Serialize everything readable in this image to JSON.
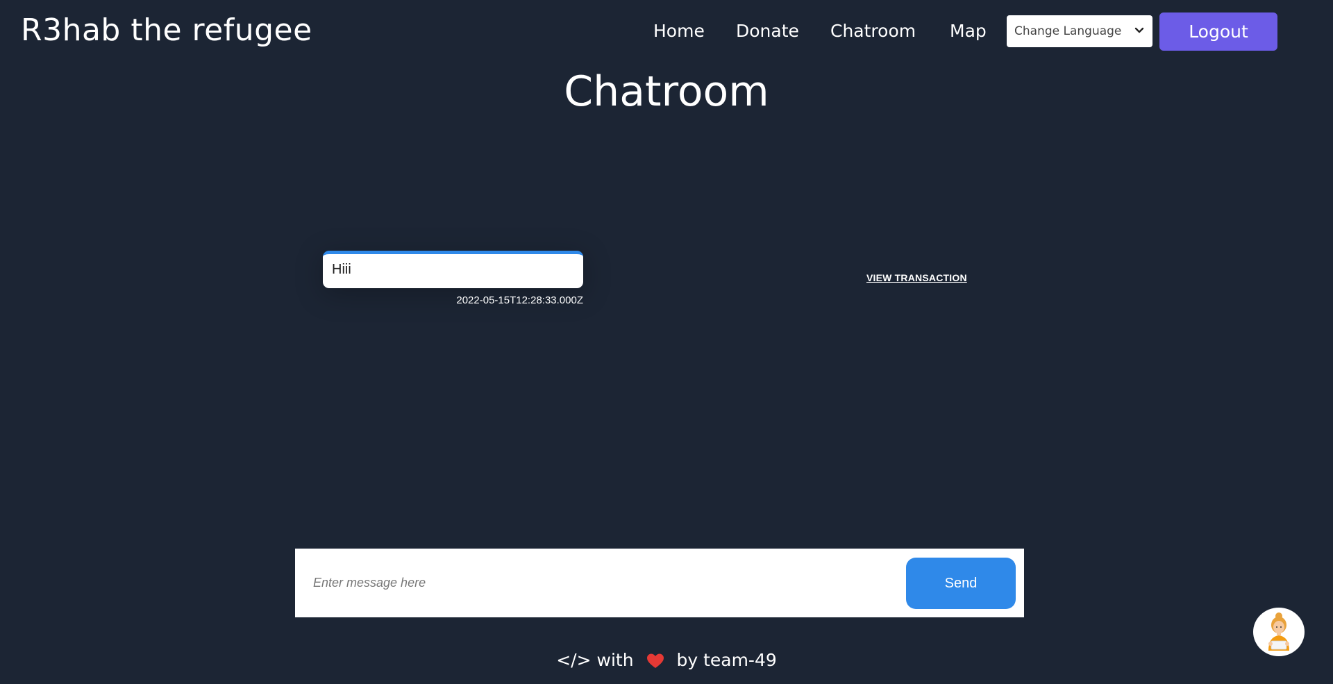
{
  "header": {
    "brand": "R3hab the refugee",
    "nav": [
      {
        "label": "Home"
      },
      {
        "label": "Donate"
      },
      {
        "label": "Chatroom"
      },
      {
        "label": "Map"
      }
    ],
    "language_select": "Change Language",
    "logout_label": "Logout",
    "logout_color": "#6c5ce7"
  },
  "page": {
    "title": "Chatroom"
  },
  "messages": [
    {
      "text": "Hiii",
      "timestamp": "2022-05-15T12:28:33.000Z",
      "action_label": "VIEW TRANSACTION"
    }
  ],
  "composer": {
    "placeholder": "Enter message here",
    "send_label": "Send",
    "send_color": "#2f89e9"
  },
  "footer": {
    "prefix": "</> with",
    "suffix": "by team-49",
    "heart_icon": "heart-icon"
  },
  "assistant": {
    "icon": "assistant-avatar-icon"
  },
  "colors": {
    "background": "#1c2534",
    "accent_purple": "#6c5ce7",
    "accent_blue": "#2f89e9"
  }
}
